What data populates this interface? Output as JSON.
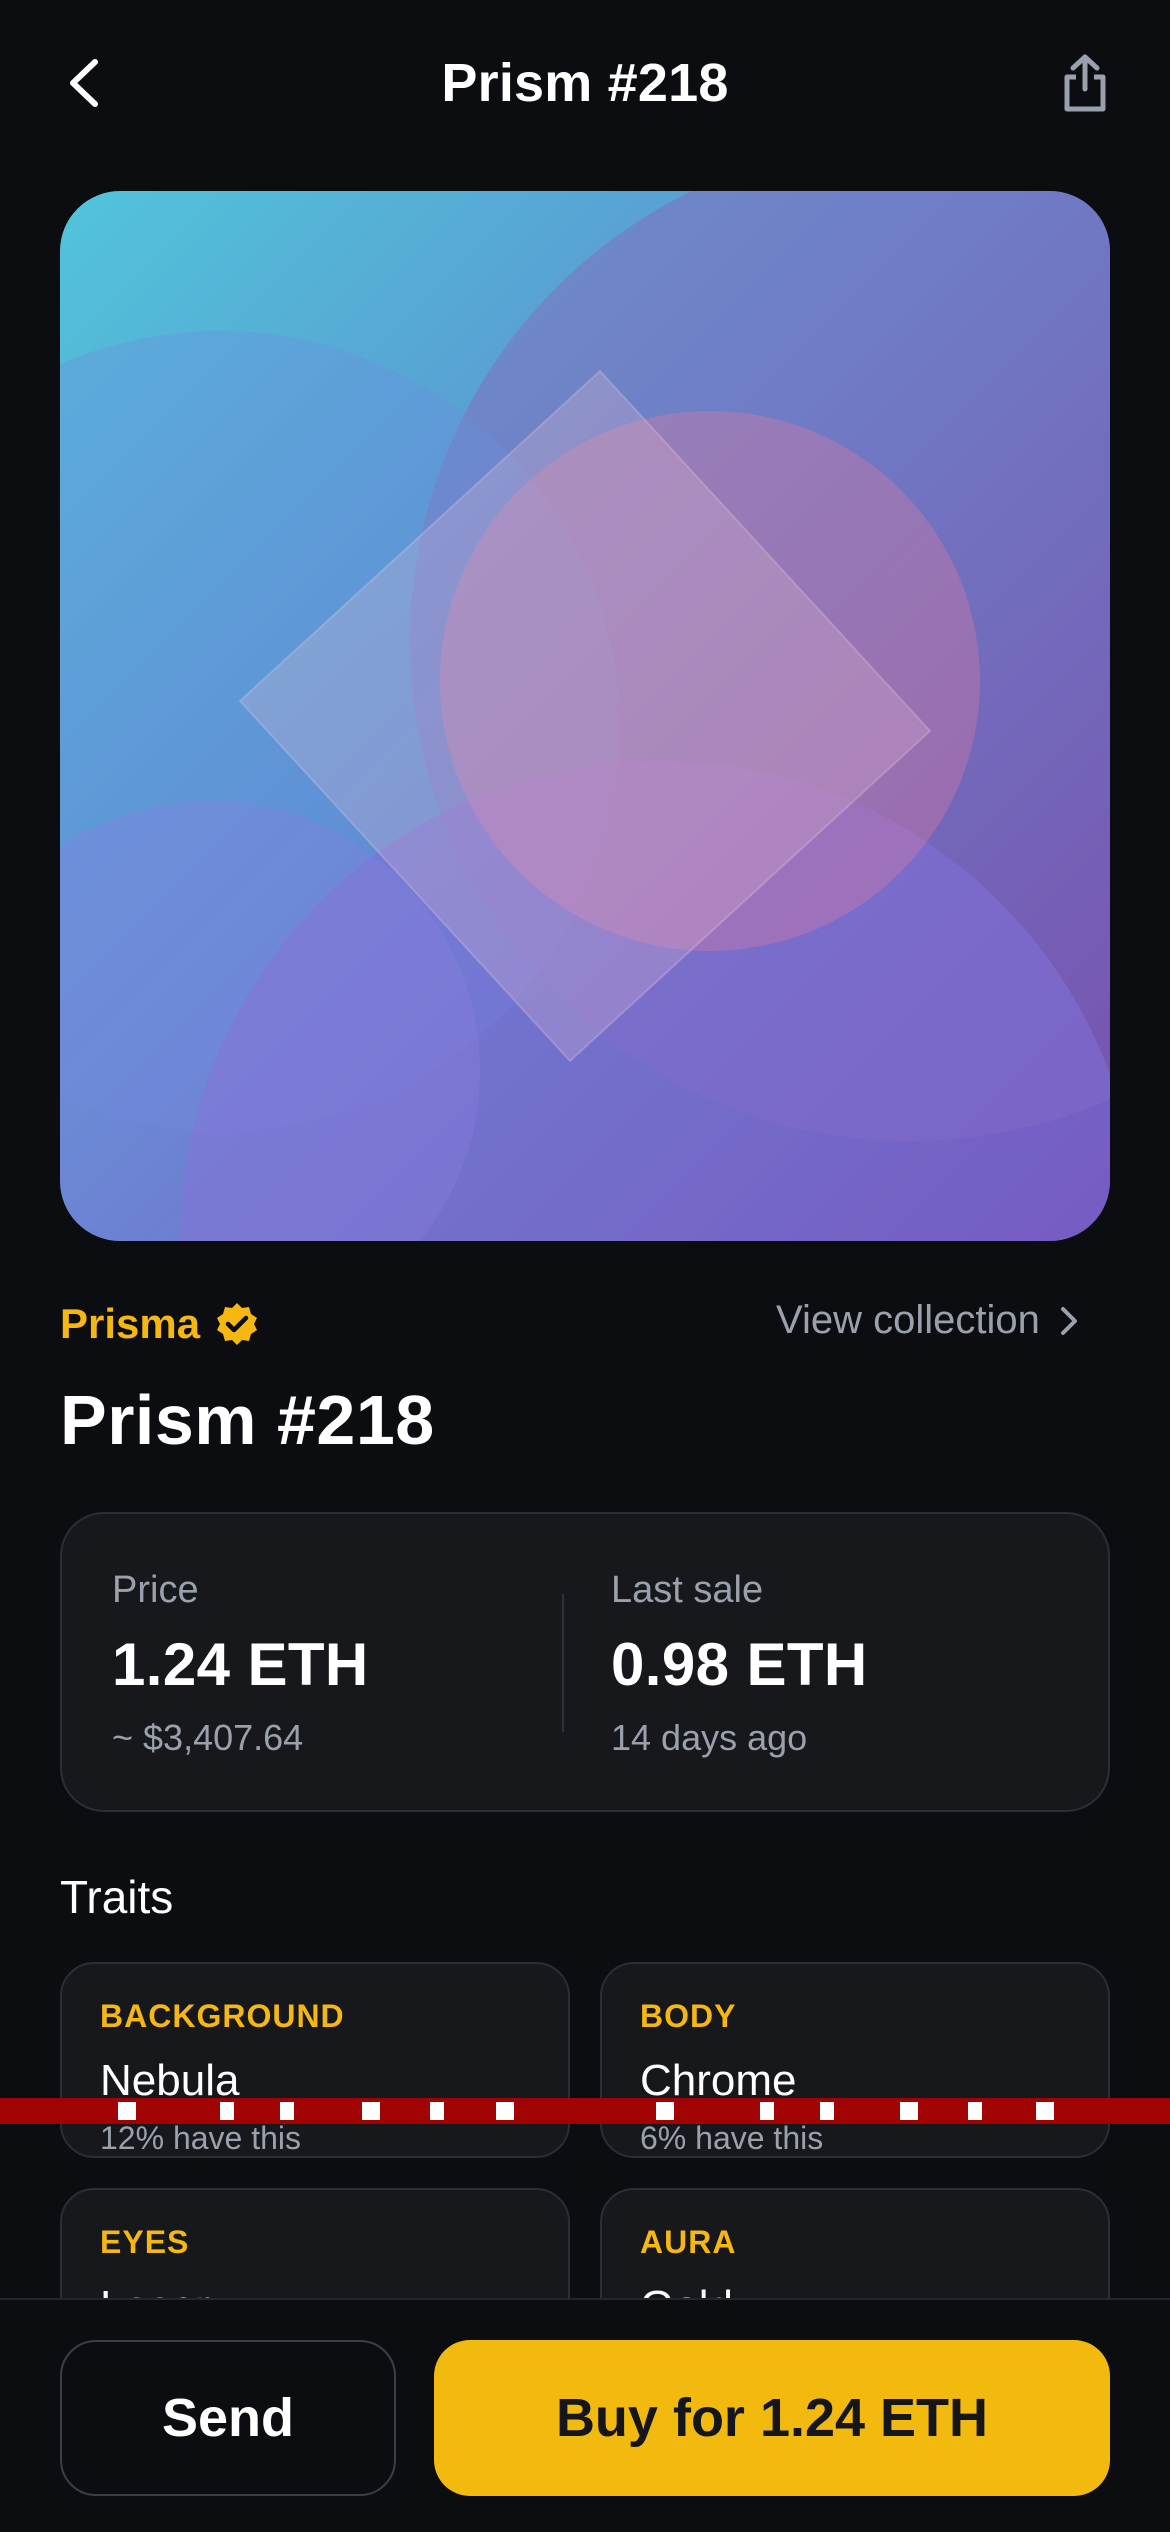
{
  "header": {
    "title": "Prism #218",
    "back_icon": "chevron-left-icon",
    "share_icon": "share-icon"
  },
  "artwork": {
    "alt": "Prism #218 artwork",
    "colors": [
      "#4fc3dd",
      "#6f86d8",
      "#8a59b8",
      "#d078a0"
    ]
  },
  "collection": {
    "name": "Prisma",
    "verified_icon": "verified-badge-icon",
    "verified_color": "#f5b710",
    "view_label": "View collection"
  },
  "nft": {
    "title": "Prism #218"
  },
  "price": {
    "label": "Price",
    "value": "1.24 ETH",
    "fiat": "~ $3,407.64",
    "last_sale_label": "Last sale",
    "last_sale_value": "0.98 ETH",
    "last_sale_time": "14 days ago"
  },
  "traits": {
    "title": "Traits",
    "items": [
      {
        "type": "BACKGROUND",
        "value": "Nebula",
        "rarity": "12% have this"
      },
      {
        "type": "BODY",
        "value": "Chrome",
        "rarity": "6% have this"
      },
      {
        "type": "EYES",
        "value": "Laser",
        "rarity": ""
      },
      {
        "type": "AURA",
        "value": "Gold",
        "rarity": ""
      }
    ]
  },
  "actions": {
    "send_label": "Send",
    "buy_label": "Buy for 1.24 ETH"
  },
  "theme": {
    "accent": "#f2b90e",
    "background": "#0b0d10",
    "card": "#16181c",
    "muted": "#9aa1ad"
  }
}
